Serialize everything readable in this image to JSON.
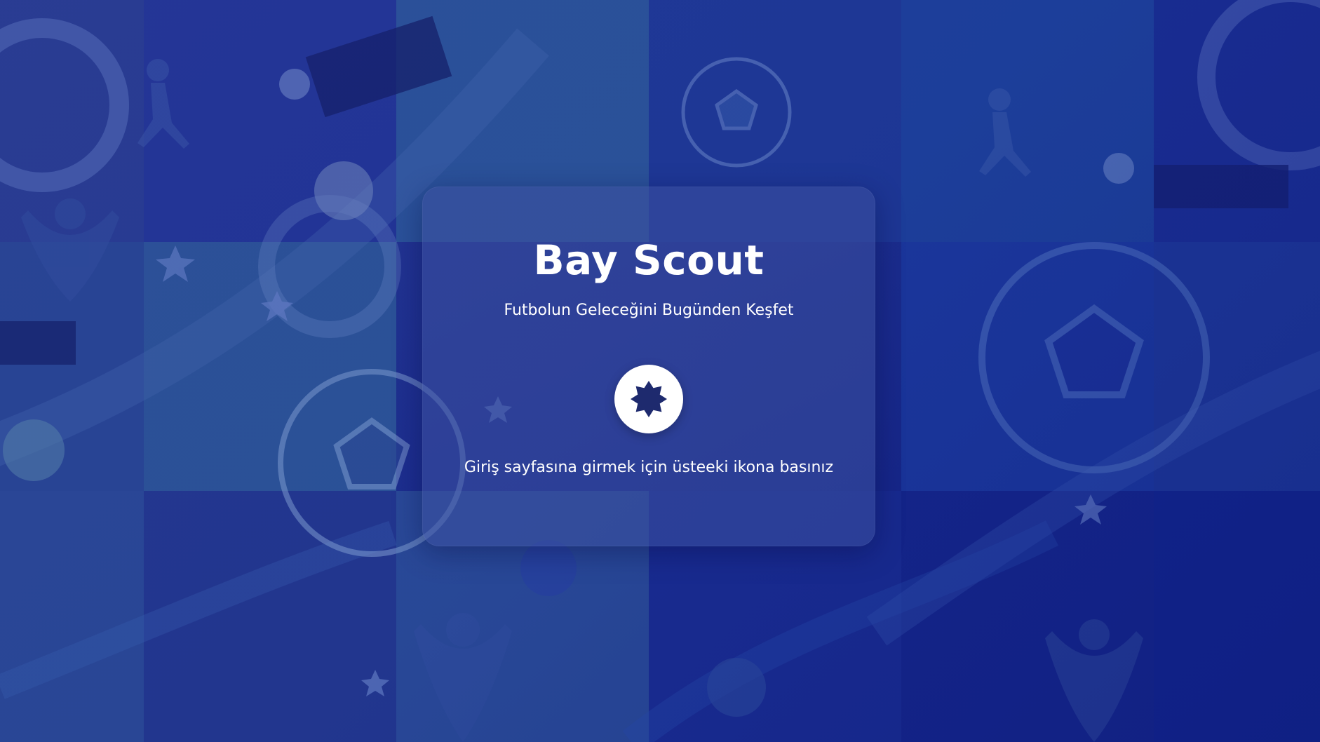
{
  "app": {
    "title": "Bay Scout",
    "tagline": "Futbolun Geleceğini Bugünden Keşfet",
    "hint": "Giriş sayfasına girmek için üsteeki ikona basınız"
  },
  "enter_button": {
    "icon": "badge-star-icon",
    "aria_label": "Giriş"
  },
  "theme": {
    "background": "#1b2f8c",
    "card": "#3c50a0",
    "text": "#ffffff",
    "icon_bg": "#ffffff",
    "icon_fg": "#1e2a6e"
  }
}
